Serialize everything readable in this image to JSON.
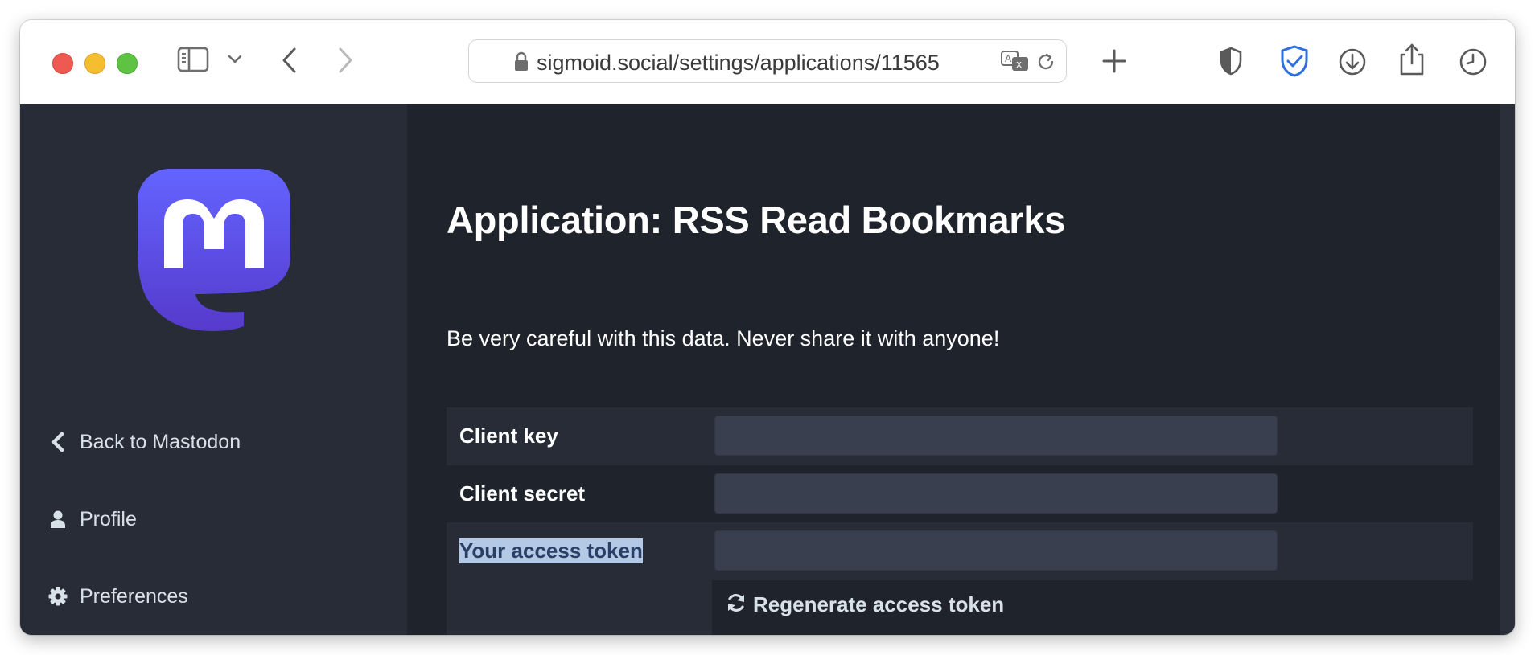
{
  "browser": {
    "url": "sigmoid.social/settings/applications/11565"
  },
  "sidebar": {
    "logo": "mastodon-logo",
    "items": [
      {
        "label": "Back to Mastodon",
        "icon": "chevron-left-icon"
      },
      {
        "label": "Profile",
        "icon": "user-icon"
      },
      {
        "label": "Preferences",
        "icon": "gear-icon"
      }
    ]
  },
  "main": {
    "title": "Application: RSS Read Bookmarks",
    "warning": "Be very careful with this data. Never share it with anyone!",
    "fields": [
      {
        "label": "Client key",
        "value": ""
      },
      {
        "label": "Client secret",
        "value": ""
      },
      {
        "label": "Your access token",
        "value": "",
        "selected": true
      }
    ],
    "regenerate_label": "Regenerate access token"
  },
  "colors": {
    "sidebar_bg": "#282c37",
    "content_bg": "#1f232b",
    "field_bg": "#393f4f",
    "brand": "#6364ff"
  }
}
